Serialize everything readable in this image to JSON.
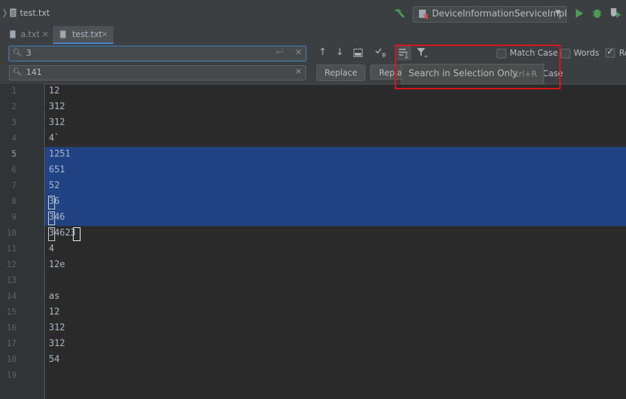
{
  "title": {
    "file_name": "test.txt"
  },
  "toolbar": {
    "run_config": "DeviceInformationServiceImpl"
  },
  "tabs": [
    {
      "label": "a.txt"
    },
    {
      "label": "test.txt"
    }
  ],
  "find": {
    "search_value": "3",
    "replace_value": "141",
    "replace_label": "Replace",
    "replace_all_label": "Replac",
    "match_case_label": "Match Case",
    "words_label": "Words",
    "regex_label": "Re",
    "preserve_case_partial": "Case",
    "tooltip": {
      "text": "Search in Selection Only",
      "shortcut": "Ctrl+R"
    }
  },
  "editor": {
    "lines": [
      {
        "n": "1",
        "text": "12"
      },
      {
        "n": "2",
        "text": "312"
      },
      {
        "n": "3",
        "text": "312"
      },
      {
        "n": "4",
        "text": "4`"
      },
      {
        "n": "5",
        "text": "1251"
      },
      {
        "n": "6",
        "text": "651"
      },
      {
        "n": "7",
        "text": "52"
      },
      {
        "n": "8",
        "text": "36"
      },
      {
        "n": "9",
        "text": "346"
      },
      {
        "n": "10",
        "text": "34623"
      },
      {
        "n": "11",
        "text": "4"
      },
      {
        "n": "12",
        "text": "12e"
      },
      {
        "n": "13",
        "text": ""
      },
      {
        "n": "14",
        "text": "as"
      },
      {
        "n": "15",
        "text": "12"
      },
      {
        "n": "16",
        "text": "312"
      },
      {
        "n": "17",
        "text": "312"
      },
      {
        "n": "18",
        "text": "54"
      },
      {
        "n": "19",
        "text": ""
      }
    ]
  },
  "colors": {
    "selection": "#214283",
    "highlight_box": "#e3131a",
    "run": "#499c54"
  }
}
